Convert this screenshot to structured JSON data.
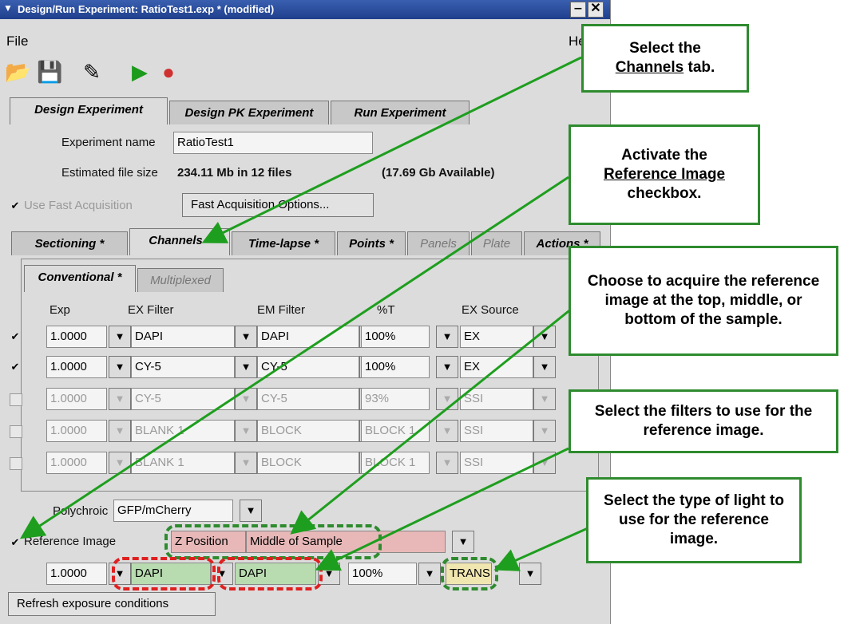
{
  "window": {
    "title": "Design/Run Experiment: RatioTest1.exp * (modified)"
  },
  "menu": {
    "file": "File",
    "help": "He"
  },
  "main_tabs": [
    "Design Experiment",
    "Design PK Experiment",
    "Run Experiment"
  ],
  "experiment": {
    "name_label": "Experiment name",
    "name_value": "RatioTest1",
    "size_label": "Estimated file size",
    "size_value": "234.11 Mb in 12 files",
    "available": "(17.69 Gb Available)",
    "fast_acq_label": "Use Fast Acquisition",
    "fast_acq_button": "Fast Acquisition Options..."
  },
  "sub_tabs": [
    "Sectioning *",
    "Channels *",
    "Time-lapse *",
    "Points *",
    "Panels",
    "Plate",
    "Actions *"
  ],
  "inner_tabs": [
    "Conventional *",
    "Multiplexed"
  ],
  "columns": {
    "exp": "Exp",
    "ex_filter": "EX Filter",
    "em_filter": "EM Filter",
    "pct_t": "%T",
    "ex_source": "EX Source"
  },
  "channels": [
    {
      "exp": "1.0000",
      "ex": "DAPI",
      "em": "DAPI",
      "t": "100%",
      "src": "EX",
      "checked": "✔"
    },
    {
      "exp": "1.0000",
      "ex": "CY-5",
      "em": "CY-5",
      "t": "100%",
      "src": "EX",
      "checked": "✔"
    },
    {
      "exp": "1.0000",
      "ex": "CY-5",
      "em": "CY-5",
      "t": "93%",
      "src": "SSI",
      "checked": ""
    },
    {
      "exp": "1.0000",
      "ex": "BLANK 1",
      "em": "BLOCK",
      "t": "BLOCK 1",
      "src": "SSI",
      "checked": ""
    },
    {
      "exp": "1.0000",
      "ex": "BLANK 1",
      "em": "BLOCK",
      "t": "BLOCK 1",
      "src": "SSI",
      "checked": ""
    }
  ],
  "polychroic": {
    "label": "Polychroic",
    "value": "GFP/mCherry"
  },
  "reference": {
    "label": "Reference Image",
    "z_label": "Z Position",
    "z_value": "Middle of Sample",
    "exp": "1.0000",
    "ex": "DAPI",
    "em": "DAPI",
    "t": "100%",
    "src": "TRANS"
  },
  "refresh_button": "Refresh exposure conditions",
  "callouts": {
    "c1_pre": "Select the",
    "c1_u": "Channels",
    "c1_post": "tab.",
    "c2_pre": "Activate the",
    "c2_u": "Reference Image",
    "c2_post": "checkbox.",
    "c3": "Choose to acquire the reference image at the top, middle, or bottom of the sample.",
    "c4": "Select the filters to use for the reference image.",
    "c5": "Select the type of light to use for the reference image."
  },
  "colors": {
    "callout_border": "#2e8b2e",
    "red_dash": "#e02020",
    "green_dash": "#2e8b2e"
  }
}
